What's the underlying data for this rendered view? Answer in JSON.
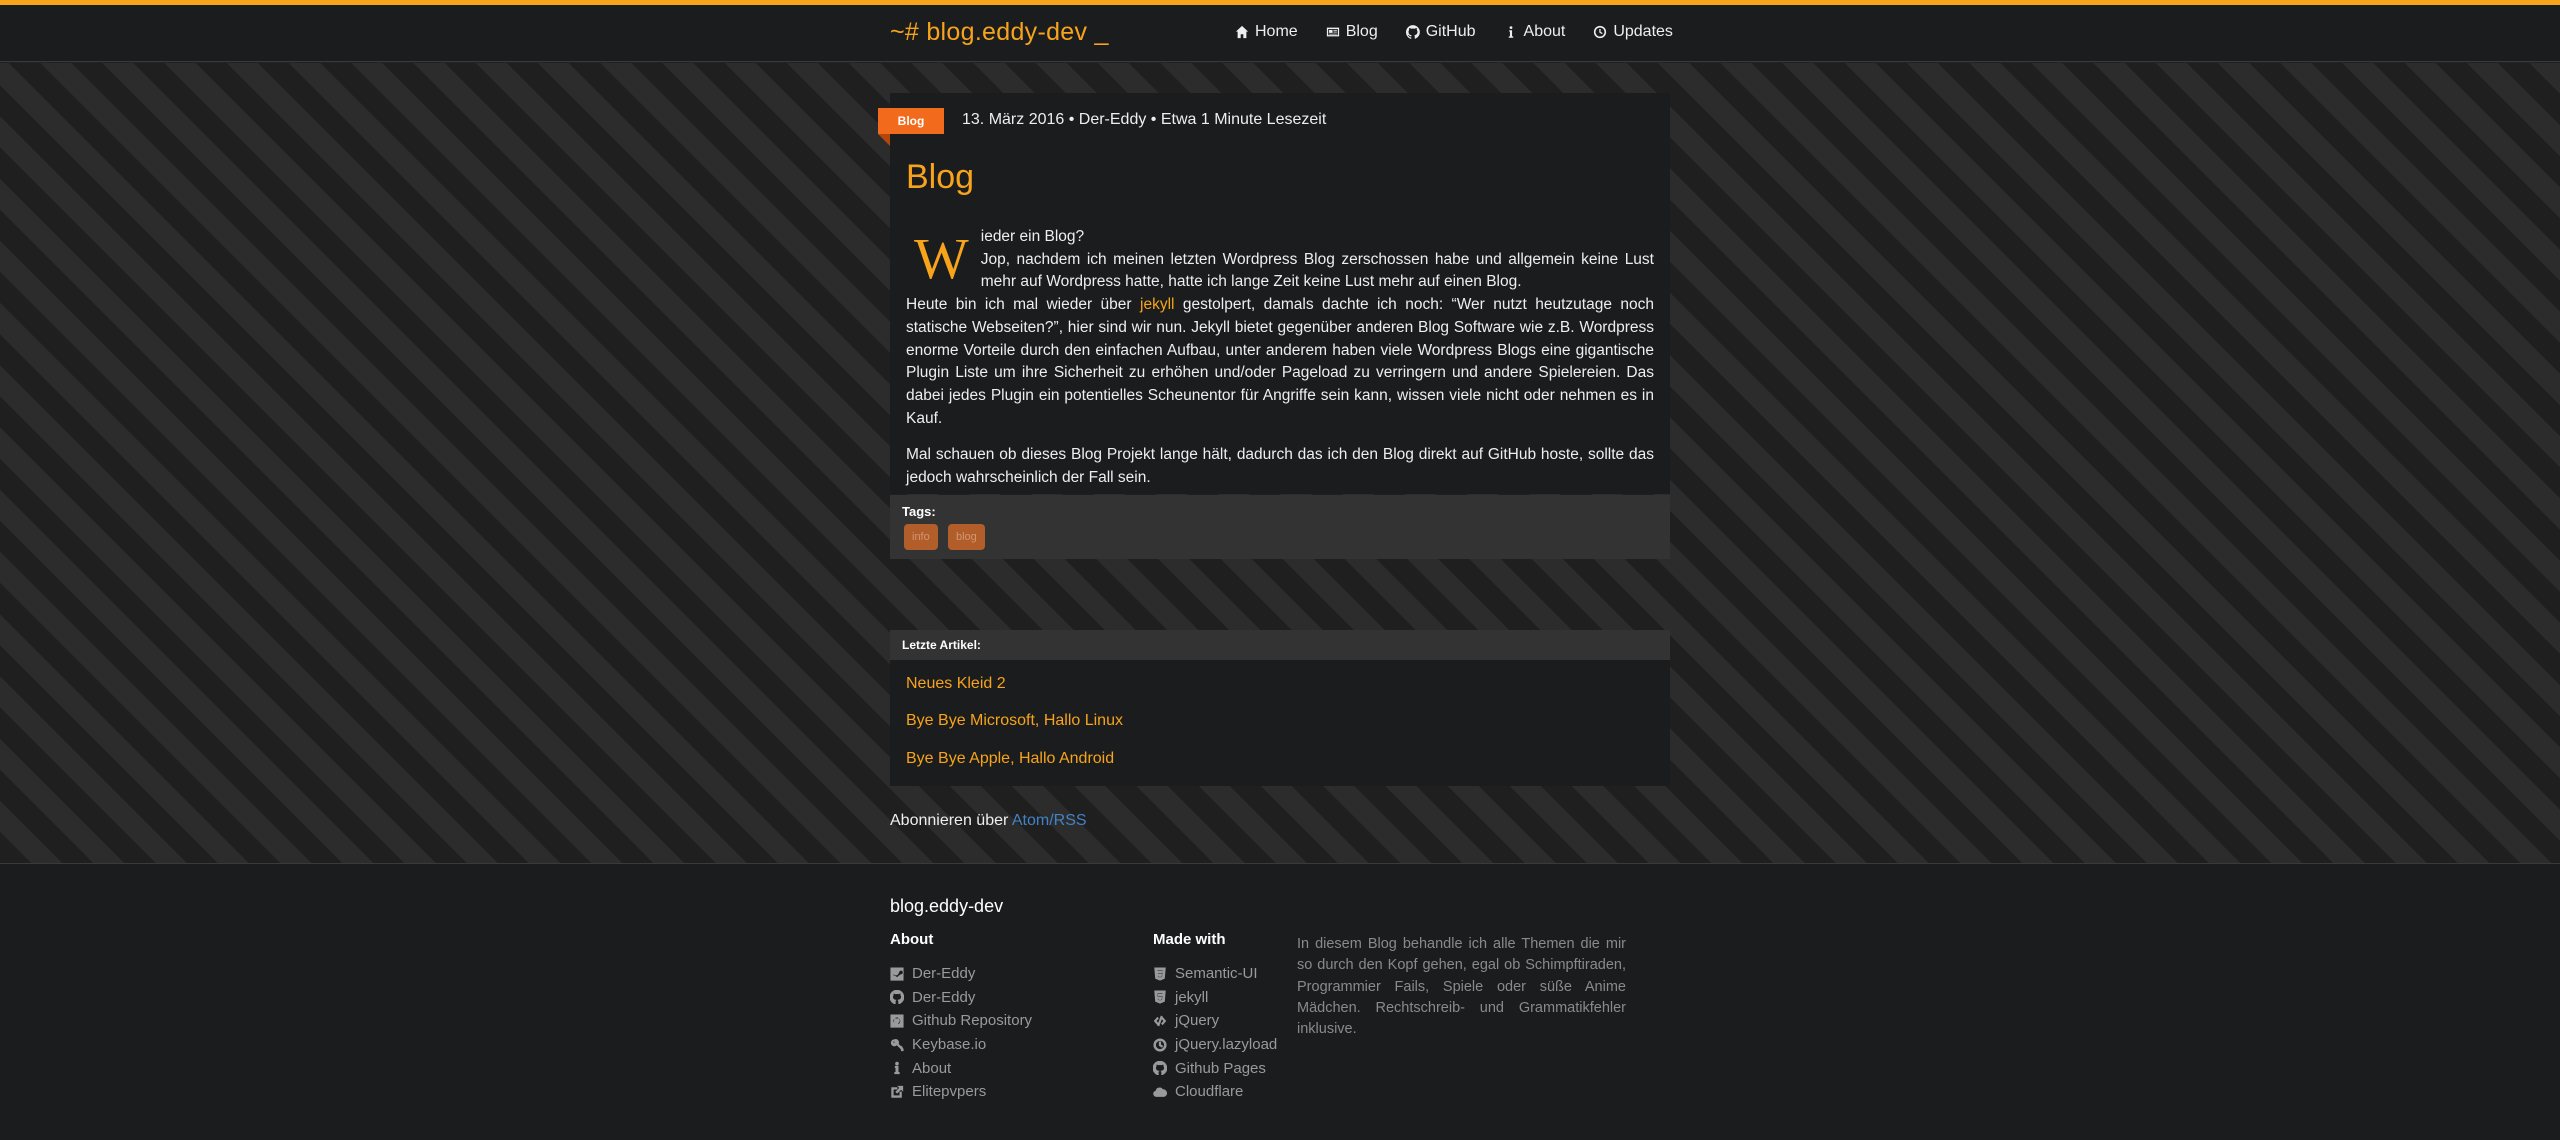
{
  "site": {
    "brand": "~# blog.eddy-dev _"
  },
  "nav": {
    "items": [
      {
        "label": "Home",
        "icon": "home-icon"
      },
      {
        "label": "Blog",
        "icon": "newspaper-icon"
      },
      {
        "label": "GitHub",
        "icon": "github-icon"
      },
      {
        "label": "About",
        "icon": "info-icon"
      },
      {
        "label": "Updates",
        "icon": "clock-icon"
      }
    ]
  },
  "post": {
    "ribbon": "Blog",
    "meta": "13. März 2016 • Der-Eddy • Etwa 1 Minute Lesezeit",
    "title": "Blog",
    "dropcap": "W",
    "p1_line1": "ieder ein Blog?",
    "p1_rest": "Jop, nachdem ich meinen letzten Wordpress Blog zerschossen habe und allgemein keine Lust mehr auf Wordpress hatte, hatte ich lange Zeit keine Lust mehr auf einen Blog.",
    "p2_before": "Heute bin ich mal wieder über ",
    "p2_link": "jekyll",
    "p2_after": " gestolpert, damals dachte ich noch: “Wer nutzt heutzutage noch statische Webseiten?”, hier sind wir nun. Jekyll bietet gegenüber anderen Blog Software wie z.B. Wordpress enorme Vorteile durch den einfachen Aufbau, unter anderem haben viele Wordpress Blogs eine gigantische Plugin Liste um ihre Sicherheit zu erhöhen und/oder Pageload zu verringern und andere Spielereien. Das dabei jedes Plugin ein potentielles Scheunentor für Angriffe sein kann, wissen viele nicht oder nehmen es in Kauf.",
    "p3": "Mal schauen ob dieses Blog Projekt lange hält, dadurch das ich den Blog direkt auf GitHub hoste, sollte das jedoch wahrscheinlich der Fall sein."
  },
  "tags": {
    "label": "Tags:",
    "items": [
      "info",
      "blog"
    ]
  },
  "recent": {
    "heading": "Letzte Artikel:",
    "items": [
      "Neues Kleid 2",
      "Bye Bye Microsoft, Hallo Linux",
      "Bye Bye Apple, Hallo Android"
    ]
  },
  "subscribe": {
    "text": "Abonnieren über ",
    "link": "Atom/RSS"
  },
  "footer": {
    "title": "blog.eddy-dev",
    "about_heading": "About",
    "about_items": [
      {
        "label": "Der-Eddy",
        "icon": "steam-icon"
      },
      {
        "label": "Der-Eddy",
        "icon": "github-icon"
      },
      {
        "label": "Github Repository",
        "icon": "github-square-icon"
      },
      {
        "label": "Keybase.io",
        "icon": "key-icon"
      },
      {
        "label": "About",
        "icon": "info-icon"
      },
      {
        "label": "Elitepvpers",
        "icon": "external-link-icon"
      }
    ],
    "made_heading": "Made with",
    "made_items": [
      {
        "label": "Semantic-UI",
        "icon": "css3-icon"
      },
      {
        "label": "jekyll",
        "icon": "html5-icon"
      },
      {
        "label": "jQuery",
        "icon": "code-icon"
      },
      {
        "label": "jQuery.lazyload",
        "icon": "clock-icon"
      },
      {
        "label": "Github Pages",
        "icon": "github-icon"
      },
      {
        "label": "Cloudflare",
        "icon": "cloud-icon"
      }
    ],
    "description": "In diesem Blog behandle ich alle Themen die mir so durch den Kopf gehen, egal ob Schimpftiraden, Programmier Fails, Spiele oder süße Anime Mädchen. Rechtschreib- und Grammatikfehler inklusive."
  }
}
